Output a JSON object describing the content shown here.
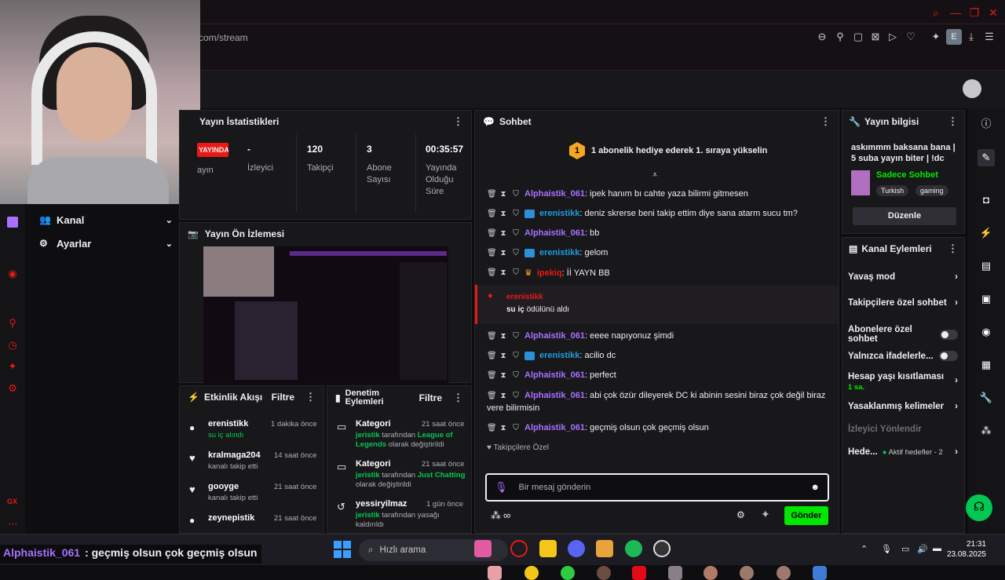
{
  "browser": {
    "url": "com/stream",
    "ext_letter": "E"
  },
  "nav": {
    "channel": "Kanal",
    "settings": "Ayarlar"
  },
  "stats": {
    "title": "Yayın İstatistikleri",
    "live_badge": "YAYINDA",
    "live_label": "ayın",
    "viewers_value": "-",
    "viewers_label": "İzleyici",
    "followers_value": "120",
    "followers_label": "Takipçi",
    "subs_value": "3",
    "subs_label": "Abone Sayısı",
    "uptime_value": "00:35:57",
    "uptime_label": "Yayında Olduğu Süre"
  },
  "preview": {
    "title": "Yayın Ön İzlemesi"
  },
  "activity": {
    "title": "Etkinlik Akışı",
    "filter": "Filtre",
    "items": [
      {
        "name": "erenistikk",
        "sub": "su iç alındı",
        "time": "1 dakika önce"
      },
      {
        "name": "kralmaga204",
        "sub": "kanalı takip etti",
        "time": "14 saat önce"
      },
      {
        "name": "gooyge",
        "sub": "kanalı takip etti",
        "time": "21 saat önce"
      },
      {
        "name": "zeynepistik",
        "sub": "",
        "time": "21 saat önce"
      }
    ]
  },
  "moderation": {
    "title": "Denetim Eylemleri",
    "filter": "Filtre",
    "items": [
      {
        "name": "Kategori",
        "time": "21 saat önce",
        "actor": "jeristik",
        "mid": "tarafından",
        "target": "League of Legends",
        "tail": "olarak değiştirildi"
      },
      {
        "name": "Kategori",
        "time": "21 saat önce",
        "actor": "jeristik",
        "mid": "tarafından",
        "target": "Just Chatting",
        "tail": "olarak değiştirildi"
      },
      {
        "name": "yessiryilmaz",
        "time": "1 gün önce",
        "actor": "jeristik",
        "mid": "tarafından yasağı",
        "target": "",
        "tail": "kaldırıldı"
      }
    ]
  },
  "chat": {
    "title": "Sohbet",
    "pinned": "1 abonelik hediye ederek 1. sıraya yükselin",
    "pinned_rank": "1",
    "messages": [
      {
        "user": "Alphaistik_061",
        "color": "purple",
        "text": ": ipek hanım bı cahte yaza bilirmi gitmesen"
      },
      {
        "user": "erenistikk",
        "color": "blue",
        "text": ": deniz skrerse beni takip ettim diye sana atarm sucu tm?"
      },
      {
        "user": "Alphaistik_061",
        "color": "purple",
        "text": ": bb"
      },
      {
        "user": "erenistikk",
        "color": "blue",
        "text": ": gelom"
      },
      {
        "user": "ipekiq",
        "color": "red",
        "text": ": İİ YAYN BB"
      }
    ],
    "redeem_user": "erenistikk",
    "redeem_item": "su iç",
    "redeem_text": "ödülünü aldı",
    "messages2": [
      {
        "user": "Alphaistik_061",
        "color": "purple",
        "text": ": eeee napıyonuz şimdi"
      },
      {
        "user": "erenistikk",
        "color": "blue",
        "text": ": acilio dc"
      },
      {
        "user": "Alphaistik_061",
        "color": "purple",
        "text": ": perfect"
      },
      {
        "user": "Alphaistik_061",
        "color": "purple",
        "text": ": abi çok özür dileyerek DC ki abinin sesini biraz çok değil biraz"
      },
      {
        "user": "Alphaistik_061",
        "color": "purple",
        "text": ": geçmiş olsun çok geçmiş olsun"
      }
    ],
    "wrap_line": "vere bilirmisin",
    "followers_only": "Takipçilere Özel",
    "placeholder": "Bir mesaj gönderin",
    "infinity": "∞",
    "send": "Gönder"
  },
  "stream_info": {
    "title": "Yayın bilgisi",
    "stream_title": "askımmm baksana bana | 5 suba yayın biter | !dc",
    "category": "Sadece Sohbet",
    "tags": [
      "Turkish",
      "gaming"
    ],
    "edit": "Düzenle"
  },
  "channel_actions": {
    "title": "Kanal Eylemleri",
    "slow": "Yavaş mod",
    "followers_chat": "Takipçilere özel sohbet",
    "subs_chat": "Abonelere özel sohbet",
    "emote_only": "Yalnızca ifadelerle...",
    "account_age": "Hesap yaşı kısıtlaması",
    "account_age_value": "1 sa.",
    "banned_words": "Yasaklanmış kelimeler",
    "redirect": "İzleyici Yönlendir",
    "goals": "Hede...",
    "goals_active": "Aktif hedefler - 2"
  },
  "rail": {
    "gx": "GX"
  },
  "taskbar": {
    "search": "Hızlı arama",
    "time": "21:31",
    "date": "23.08.2025"
  },
  "subtitle": {
    "user": "Alphaistik_061",
    "text": ": geçmiş olsun çok geçmiş olsun"
  },
  "colors": {
    "accent": "#e91916",
    "purple": "#a970ff",
    "blue": "#1f9bde",
    "green": "#00c853",
    "send": "#00e701"
  }
}
